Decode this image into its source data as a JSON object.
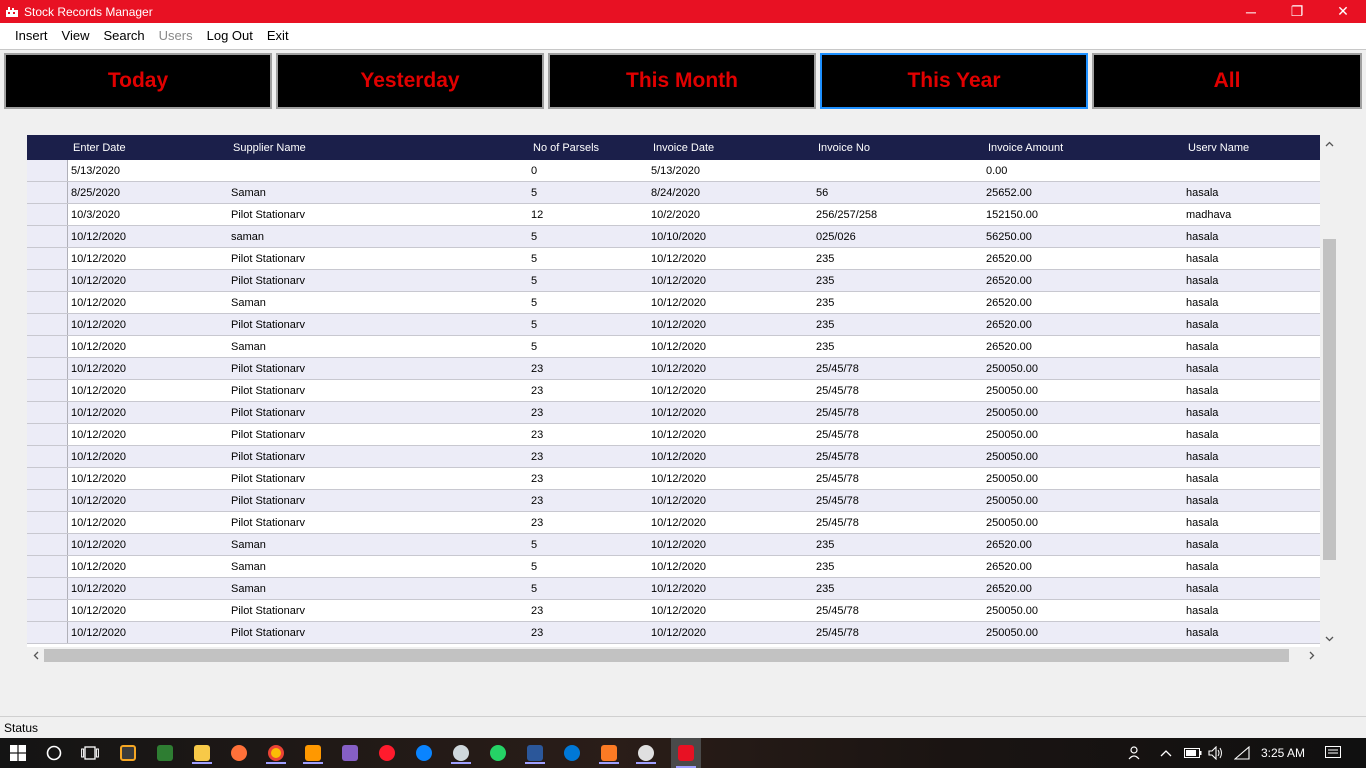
{
  "window": {
    "title": "Stock Records Manager",
    "minimize_label": "─",
    "restore_label": "❐",
    "close_label": "✕"
  },
  "menu": [
    {
      "label": "Insert",
      "enabled": true
    },
    {
      "label": "View",
      "enabled": true
    },
    {
      "label": "Search",
      "enabled": true
    },
    {
      "label": "Users",
      "enabled": false
    },
    {
      "label": "Log Out",
      "enabled": true
    },
    {
      "label": "Exit",
      "enabled": true
    }
  ],
  "filters": [
    {
      "label": "Today",
      "active": false
    },
    {
      "label": "Yesterday",
      "active": false
    },
    {
      "label": "This Month",
      "active": false
    },
    {
      "label": "This Year",
      "active": true
    },
    {
      "label": "All",
      "active": false
    }
  ],
  "grid": {
    "columns": [
      "Enter Date",
      "Supplier Name",
      "No of Parsels",
      "Invoice Date",
      "Invoice No",
      "Invoice Amount",
      "Userv Name"
    ],
    "rows": [
      [
        "5/13/2020",
        "",
        "0",
        "5/13/2020",
        "",
        "0.00",
        ""
      ],
      [
        "8/25/2020",
        "Saman",
        "5",
        "8/24/2020",
        "56",
        "25652.00",
        "hasala"
      ],
      [
        "10/3/2020",
        "Pilot Stationarv",
        "12",
        "10/2/2020",
        "256/257/258",
        "152150.00",
        "madhava"
      ],
      [
        "10/12/2020",
        "saman",
        "5",
        "10/10/2020",
        "025/026",
        "56250.00",
        "hasala"
      ],
      [
        "10/12/2020",
        "Pilot Stationarv",
        "5",
        "10/12/2020",
        "235",
        "26520.00",
        "hasala"
      ],
      [
        "10/12/2020",
        "Pilot Stationarv",
        "5",
        "10/12/2020",
        "235",
        "26520.00",
        "hasala"
      ],
      [
        "10/12/2020",
        "Saman",
        "5",
        "10/12/2020",
        "235",
        "26520.00",
        "hasala"
      ],
      [
        "10/12/2020",
        "Pilot Stationarv",
        "5",
        "10/12/2020",
        "235",
        "26520.00",
        "hasala"
      ],
      [
        "10/12/2020",
        "Saman",
        "5",
        "10/12/2020",
        "235",
        "26520.00",
        "hasala"
      ],
      [
        "10/12/2020",
        "Pilot Stationarv",
        "23",
        "10/12/2020",
        "25/45/78",
        "250050.00",
        "hasala"
      ],
      [
        "10/12/2020",
        "Pilot Stationarv",
        "23",
        "10/12/2020",
        "25/45/78",
        "250050.00",
        "hasala"
      ],
      [
        "10/12/2020",
        "Pilot Stationarv",
        "23",
        "10/12/2020",
        "25/45/78",
        "250050.00",
        "hasala"
      ],
      [
        "10/12/2020",
        "Pilot Stationarv",
        "23",
        "10/12/2020",
        "25/45/78",
        "250050.00",
        "hasala"
      ],
      [
        "10/12/2020",
        "Pilot Stationarv",
        "23",
        "10/12/2020",
        "25/45/78",
        "250050.00",
        "hasala"
      ],
      [
        "10/12/2020",
        "Pilot Stationarv",
        "23",
        "10/12/2020",
        "25/45/78",
        "250050.00",
        "hasala"
      ],
      [
        "10/12/2020",
        "Pilot Stationarv",
        "23",
        "10/12/2020",
        "25/45/78",
        "250050.00",
        "hasala"
      ],
      [
        "10/12/2020",
        "Pilot Stationarv",
        "23",
        "10/12/2020",
        "25/45/78",
        "250050.00",
        "hasala"
      ],
      [
        "10/12/2020",
        "Saman",
        "5",
        "10/12/2020",
        "235",
        "26520.00",
        "hasala"
      ],
      [
        "10/12/2020",
        "Saman",
        "5",
        "10/12/2020",
        "235",
        "26520.00",
        "hasala"
      ],
      [
        "10/12/2020",
        "Saman",
        "5",
        "10/12/2020",
        "235",
        "26520.00",
        "hasala"
      ],
      [
        "10/12/2020",
        "Pilot Stationarv",
        "23",
        "10/12/2020",
        "25/45/78",
        "250050.00",
        "hasala"
      ],
      [
        "10/12/2020",
        "Pilot Stationarv",
        "23",
        "10/12/2020",
        "25/45/78",
        "250050.00",
        "hasala"
      ]
    ]
  },
  "status": {
    "text": "Status"
  },
  "taskbar": {
    "icons": [
      "windows-start-icon",
      "cortana-search-icon",
      "task-view-icon",
      "sublime-text-icon",
      "photo-app-icon",
      "file-explorer-icon",
      "firefox-icon",
      "chrome-icon",
      "sublime-icon",
      "visual-studio-icon",
      "opera-icon",
      "firefox-dev-icon",
      "settings-icon",
      "whatsapp-icon",
      "word-icon",
      "edge-icon",
      "xampp-icon",
      "paint-icon",
      "stock-records-app-icon"
    ],
    "time": "3:25 AM"
  },
  "colors": {
    "title_bar": "#e81123",
    "filter_bg": "#000000",
    "filter_text": "#e00000",
    "filter_active_border": "#1e90ff",
    "grid_header": "#1b1f4a",
    "row_alt": "#ececf7"
  }
}
